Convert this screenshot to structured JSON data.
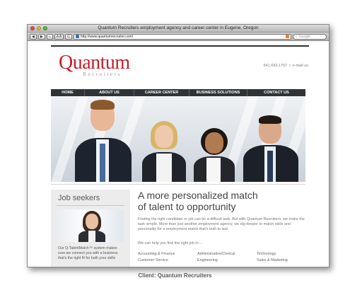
{
  "window": {
    "title": "Quantum Recruiters employment agency and career center in Eugene, Oregon"
  },
  "toolbar": {
    "back": "◀",
    "forward": "▶",
    "home": "⌂",
    "text_size": "A A",
    "reload": "C",
    "url": "http://www.quantumrecruiter.com/",
    "search_placeholder": "Google"
  },
  "site": {
    "logo_word": "Quantum",
    "logo_sub": "Recruiters",
    "phone": "541.683.1757",
    "separator": "|",
    "email": "e-mail us",
    "nav": [
      "HOME",
      "ABOUT US",
      "CAREER CENTER",
      "BUSINESS SOLUTIONS",
      "CONTACT US"
    ]
  },
  "sidebar": {
    "title": "Job seekers",
    "text": "Our Q-TalentMatch™ system makes sure we connect you with a business that's the right fit for both your skills"
  },
  "main": {
    "headline_line1": "A more personalized match",
    "headline_line2": "of talent to opportunity",
    "intro": "Finding the right candidate or job can be a difficult task. But with Quantum Recruiters, we make the task simple. More than just another employment agency, we dig deeper to match skills and personality for a employment match that's built to last.",
    "help": "We can help you find the right job in ...",
    "jobs": [
      "Accounting & Finance",
      "Administrative/Clerical",
      "Technology",
      "Customer Service",
      "Engineering",
      "Sales & Marketing"
    ]
  },
  "caption": "Client: Quantum Recruiters",
  "colors": {
    "brand_red": "#c41e28",
    "nav_bg": "#2f3338"
  }
}
